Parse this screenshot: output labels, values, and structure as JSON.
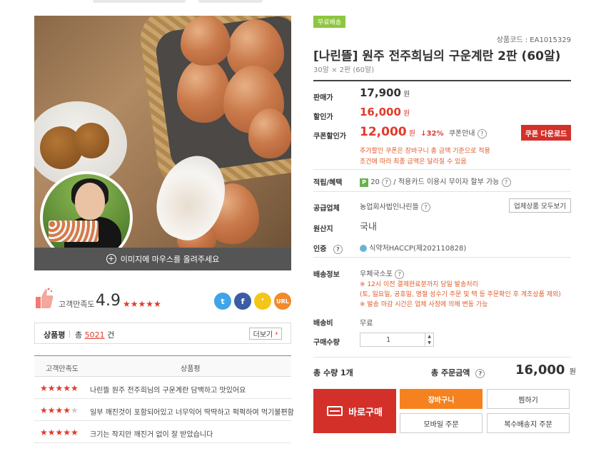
{
  "product": {
    "free_shipping_badge": "무료배송",
    "code": "상품코드 : EA1015329",
    "title": "[나린뜰] 원주 전주희님의 구운계란 2판 (60알)",
    "subtitle": "30알 × 2판 (60알)"
  },
  "image": {
    "hover_text": "이미지에 마우스를 올려주세요"
  },
  "rating": {
    "label": "고객만족도",
    "score": "4.9",
    "stars": "★★★★★"
  },
  "share": {
    "twitter": "t",
    "facebook": "f",
    "kakao": "❜",
    "url": "URL"
  },
  "review_summary": {
    "title": "상품평",
    "count_prefix": "총",
    "count": "5021",
    "count_suffix": "건",
    "more_label": "더보기"
  },
  "review_table": {
    "col_rating": "고객만족도",
    "col_review": "상품평",
    "rows": [
      {
        "stars_on": "★★★★★",
        "stars_off": "",
        "text": "나린뜰 원주 전주희님의 구운계란 담백하고 맛있어요"
      },
      {
        "stars_on": "★★★★",
        "stars_off": "★",
        "text": "일부 깨진것이 포함되어있고 너무익어 딱딱하고 퍽퍽하여 먹기불편함"
      },
      {
        "stars_on": "★★★★★",
        "stars_off": "",
        "text": "크기는 작지만 깨진거 없이 잘 받았습니다"
      }
    ]
  },
  "pricing": {
    "orig_label": "판매가",
    "orig_price": "17,900",
    "sale_label": "할인가",
    "sale_price": "16,000",
    "coupon_label": "쿠폰할인가",
    "coupon_price": "12,000",
    "coupon_rate": "↓32%",
    "coupon_info": "쿠폰안내",
    "won": "원",
    "coupon_button": "쿠폰 다운로드",
    "coupon_note_1": "추가할인 쿠폰은 장바구니 총 금액 기준으로 적용",
    "coupon_note_2": "조건에 따라 최종 금액은 달라질 수 있음"
  },
  "benefits": {
    "label": "적립/혜택",
    "points": "20",
    "card_text": "/ 적용카드 이용시 무이자 할부 가능"
  },
  "vendor": {
    "label": "공급업체",
    "name": "농업회사법인나린뜰",
    "button": "업체상품 모두보기"
  },
  "origin": {
    "label": "원산지",
    "value": "국내"
  },
  "cert": {
    "label": "인증",
    "value": "식약처HACCP(제202110828)"
  },
  "shipping": {
    "label": "배송정보",
    "method": "우체국소포",
    "note_1": "※ 12시 이전 결제완료분까지 당일 발송처리",
    "note_2": "(토, 일요일, 공휴일, 명절 성수기 주문 및 택 등 주문확인 후 계조상품 제외)",
    "note_3": "※ 발송 마감 시간은 업체 사정에 의해 변동 가능",
    "fee_label": "배송비",
    "fee_value": "무료"
  },
  "quantity": {
    "label": "구매수량",
    "value": "1"
  },
  "totals": {
    "qty_text": "총 수량 1개",
    "amount_label": "총 주문금액",
    "amount": "16,000",
    "won": "원"
  },
  "actions": {
    "buy_now": "바로구매",
    "cart": "장바구니",
    "wish": "찜하기",
    "mobile_order": "모바일 주문",
    "multi_ship": "복수배송지 주문"
  },
  "colors": {
    "accent_red": "#d3302a",
    "cart_orange": "#f5821f",
    "free_green": "#8dc63f"
  }
}
